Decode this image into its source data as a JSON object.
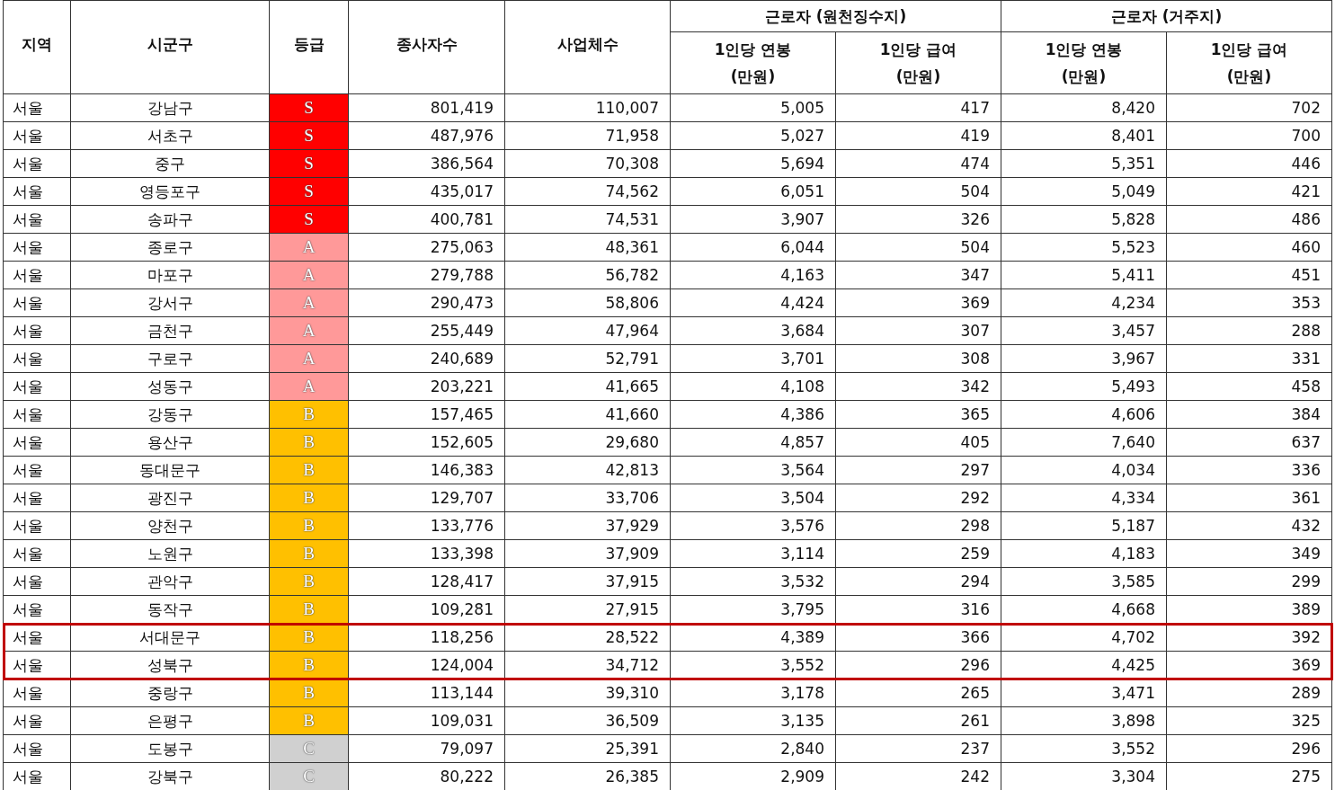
{
  "table": {
    "columns": [
      "지역",
      "시군구",
      "등급",
      "종사자수",
      "사업체수"
    ],
    "groups": [
      {
        "label": "근로자 (원천징수지)",
        "columns": [
          "1인당 연봉\n(만원)",
          "1인당 급여\n(만원)"
        ]
      },
      {
        "label": "근로자 (거주지)",
        "columns": [
          "1인당 연봉\n(만원)",
          "1인당 급여\n(만원)"
        ]
      }
    ],
    "rows": [
      {
        "region": "서울",
        "district": "강남구",
        "grade": "S",
        "color": "#ff0000",
        "values": [
          "801,419",
          "110,007",
          "5,005",
          "417",
          "8,420",
          "702"
        ],
        "highlighted": false
      },
      {
        "region": "서울",
        "district": "서초구",
        "grade": "S",
        "color": "#ff0000",
        "values": [
          "487,976",
          "71,958",
          "5,027",
          "419",
          "8,401",
          "700"
        ],
        "highlighted": false
      },
      {
        "region": "서울",
        "district": "중구",
        "grade": "S",
        "color": "#ff0000",
        "values": [
          "386,564",
          "70,308",
          "5,694",
          "474",
          "5,351",
          "446"
        ],
        "highlighted": false
      },
      {
        "region": "서울",
        "district": "영등포구",
        "grade": "S",
        "color": "#ff0000",
        "values": [
          "435,017",
          "74,562",
          "6,051",
          "504",
          "5,049",
          "421"
        ],
        "highlighted": false
      },
      {
        "region": "서울",
        "district": "송파구",
        "grade": "S",
        "color": "#ff0000",
        "values": [
          "400,781",
          "74,531",
          "3,907",
          "326",
          "5,828",
          "486"
        ],
        "highlighted": false
      },
      {
        "region": "서울",
        "district": "종로구",
        "grade": "A",
        "color": "#ff9999",
        "values": [
          "275,063",
          "48,361",
          "6,044",
          "504",
          "5,523",
          "460"
        ],
        "highlighted": false
      },
      {
        "region": "서울",
        "district": "마포구",
        "grade": "A",
        "color": "#ff9999",
        "values": [
          "279,788",
          "56,782",
          "4,163",
          "347",
          "5,411",
          "451"
        ],
        "highlighted": false
      },
      {
        "region": "서울",
        "district": "강서구",
        "grade": "A",
        "color": "#ff9999",
        "values": [
          "290,473",
          "58,806",
          "4,424",
          "369",
          "4,234",
          "353"
        ],
        "highlighted": false
      },
      {
        "region": "서울",
        "district": "금천구",
        "grade": "A",
        "color": "#ff9999",
        "values": [
          "255,449",
          "47,964",
          "3,684",
          "307",
          "3,457",
          "288"
        ],
        "highlighted": false
      },
      {
        "region": "서울",
        "district": "구로구",
        "grade": "A",
        "color": "#ff9999",
        "values": [
          "240,689",
          "52,791",
          "3,701",
          "308",
          "3,967",
          "331"
        ],
        "highlighted": false
      },
      {
        "region": "서울",
        "district": "성동구",
        "grade": "A",
        "color": "#ff9999",
        "values": [
          "203,221",
          "41,665",
          "4,108",
          "342",
          "5,493",
          "458"
        ],
        "highlighted": false
      },
      {
        "region": "서울",
        "district": "강동구",
        "grade": "B",
        "color": "#ffc000",
        "values": [
          "157,465",
          "41,660",
          "4,386",
          "365",
          "4,606",
          "384"
        ],
        "highlighted": false
      },
      {
        "region": "서울",
        "district": "용산구",
        "grade": "B",
        "color": "#ffc000",
        "values": [
          "152,605",
          "29,680",
          "4,857",
          "405",
          "7,640",
          "637"
        ],
        "highlighted": false
      },
      {
        "region": "서울",
        "district": "동대문구",
        "grade": "B",
        "color": "#ffc000",
        "values": [
          "146,383",
          "42,813",
          "3,564",
          "297",
          "4,034",
          "336"
        ],
        "highlighted": false
      },
      {
        "region": "서울",
        "district": "광진구",
        "grade": "B",
        "color": "#ffc000",
        "values": [
          "129,707",
          "33,706",
          "3,504",
          "292",
          "4,334",
          "361"
        ],
        "highlighted": false
      },
      {
        "region": "서울",
        "district": "양천구",
        "grade": "B",
        "color": "#ffc000",
        "values": [
          "133,776",
          "37,929",
          "3,576",
          "298",
          "5,187",
          "432"
        ],
        "highlighted": false
      },
      {
        "region": "서울",
        "district": "노원구",
        "grade": "B",
        "color": "#ffc000",
        "values": [
          "133,398",
          "37,909",
          "3,114",
          "259",
          "4,183",
          "349"
        ],
        "highlighted": false
      },
      {
        "region": "서울",
        "district": "관악구",
        "grade": "B",
        "color": "#ffc000",
        "values": [
          "128,417",
          "37,915",
          "3,532",
          "294",
          "3,585",
          "299"
        ],
        "highlighted": false
      },
      {
        "region": "서울",
        "district": "동작구",
        "grade": "B",
        "color": "#ffc000",
        "values": [
          "109,281",
          "27,915",
          "3,795",
          "316",
          "4,668",
          "389"
        ],
        "highlighted": false
      },
      {
        "region": "서울",
        "district": "서대문구",
        "grade": "B",
        "color": "#ffc000",
        "values": [
          "118,256",
          "28,522",
          "4,389",
          "366",
          "4,702",
          "392"
        ],
        "highlighted": true
      },
      {
        "region": "서울",
        "district": "성북구",
        "grade": "B",
        "color": "#ffc000",
        "values": [
          "124,004",
          "34,712",
          "3,552",
          "296",
          "4,425",
          "369"
        ],
        "highlighted": true
      },
      {
        "region": "서울",
        "district": "중랑구",
        "grade": "B",
        "color": "#ffc000",
        "values": [
          "113,144",
          "39,310",
          "3,178",
          "265",
          "3,471",
          "289"
        ],
        "highlighted": false
      },
      {
        "region": "서울",
        "district": "은평구",
        "grade": "B",
        "color": "#ffc000",
        "values": [
          "109,031",
          "36,509",
          "3,135",
          "261",
          "3,898",
          "325"
        ],
        "highlighted": false
      },
      {
        "region": "서울",
        "district": "도봉구",
        "grade": "C",
        "color": "#d0d0d0",
        "values": [
          "79,097",
          "25,391",
          "2,840",
          "237",
          "3,552",
          "296"
        ],
        "highlighted": false
      },
      {
        "region": "서울",
        "district": "강북구",
        "grade": "C",
        "color": "#d0d0d0",
        "values": [
          "80,222",
          "26,385",
          "2,909",
          "242",
          "3,304",
          "275"
        ],
        "highlighted": false
      }
    ]
  }
}
